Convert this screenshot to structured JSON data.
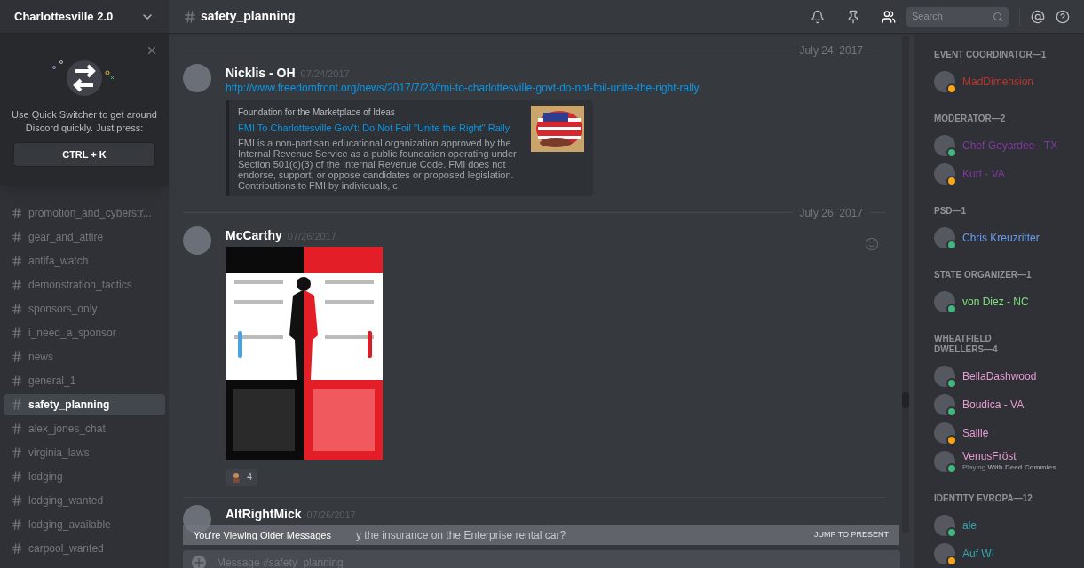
{
  "server": {
    "name": "Charlottesville 2.0"
  },
  "quick_switcher": {
    "text": "Use Quick Switcher to get around Discord quickly. Just press:",
    "shortcut": "CTRL + K"
  },
  "channels": [
    {
      "name": "promotion_and_cyberstr...",
      "selected": false
    },
    {
      "name": "gear_and_attire",
      "selected": false
    },
    {
      "name": "antifa_watch",
      "selected": false
    },
    {
      "name": "demonstration_tactics",
      "selected": false
    },
    {
      "name": "sponsors_only",
      "selected": false
    },
    {
      "name": "i_need_a_sponsor",
      "selected": false
    },
    {
      "name": "news",
      "selected": false
    },
    {
      "name": "general_1",
      "selected": false
    },
    {
      "name": "safety_planning",
      "selected": true
    },
    {
      "name": "alex_jones_chat",
      "selected": false
    },
    {
      "name": "virginia_laws",
      "selected": false
    },
    {
      "name": "lodging",
      "selected": false
    },
    {
      "name": "lodging_wanted",
      "selected": false
    },
    {
      "name": "lodging_available",
      "selected": false
    },
    {
      "name": "carpool_wanted",
      "selected": false
    }
  ],
  "header": {
    "channel": "safety_planning",
    "search_placeholder": "Search"
  },
  "messages": [
    {
      "kind": "divider",
      "date": "July 24, 2017"
    },
    {
      "kind": "message",
      "author": "Nicklis - OH",
      "timestamp": "07/24/2017",
      "link": "http://www.freedomfront.org/news/2017/7/23/fmi-to-charlottesville-govt-do-not-foil-unite-the-right-rally",
      "embed": {
        "provider": "Foundation for the Marketplace of Ideas",
        "title": "FMI To Charlottesville Gov't: Do Not Foil \"Unite the Right\" Rally",
        "description": "FMI is a non-partisan educational organization approved by the Internal Revenue Service as a public foundation operating under Section 501(c)(3) of the Internal Revenue Code.  FMI does not endorse, support, or oppose candidates or proposed legislation. Contributions to FMI by individuals, c"
      }
    },
    {
      "kind": "divider",
      "date": "July 26, 2017"
    },
    {
      "kind": "message",
      "author": "McCarthy",
      "timestamp": "07/26/2017",
      "attachment": {
        "kind": "picture"
      },
      "reactions": [
        {
          "count": "4"
        }
      ]
    },
    {
      "kind": "message",
      "author": "AltRightMick",
      "timestamp": "07/26/2017",
      "text": "y the insurance on the Enterprise rental car?"
    }
  ],
  "older_banner": {
    "text": "You're Viewing Older Messages",
    "action": "JUMP TO PRESENT"
  },
  "composer": {
    "placeholder": "Message #safety_planning"
  },
  "member_groups": [
    {
      "title": "EVENT COORDINATOR—1",
      "members": [
        {
          "name": "MadDimension",
          "color": "#b8372c",
          "idle": true
        }
      ]
    },
    {
      "title": "MODERATOR—2",
      "members": [
        {
          "name": "Chef Goyardee - TX",
          "color": "#7e3a9e",
          "idle": false
        },
        {
          "name": "Kurt - VA",
          "color": "#7e3a9e",
          "idle": true
        }
      ]
    },
    {
      "title": "PSD—1",
      "members": [
        {
          "name": "Chris Kreuzritter",
          "color": "#6b9ff0",
          "idle": false
        }
      ]
    },
    {
      "title": "STATE ORGANIZER—1",
      "members": [
        {
          "name": "von Diez - NC",
          "color": "#7fe07f",
          "idle": false
        }
      ]
    },
    {
      "title": "WHEATFIELD DWELLERS—4",
      "members": [
        {
          "name": "BellaDashwood",
          "color": "#e79bd0",
          "idle": false
        },
        {
          "name": "Boudica - VA",
          "color": "#e79bd0",
          "idle": false
        },
        {
          "name": "Sallie",
          "color": "#e79bd0",
          "idle": true
        },
        {
          "name": "VenusFröst",
          "color": "#e79bd0",
          "idle": false,
          "activity": "Playing **With Dead Commies**"
        }
      ]
    },
    {
      "title": "IDENTITY EVROPA—12",
      "members": [
        {
          "name": "ale",
          "color": "#3aa3ad",
          "idle": false
        },
        {
          "name": "Auf WI",
          "color": "#3aa3ad",
          "idle": true
        }
      ]
    }
  ]
}
